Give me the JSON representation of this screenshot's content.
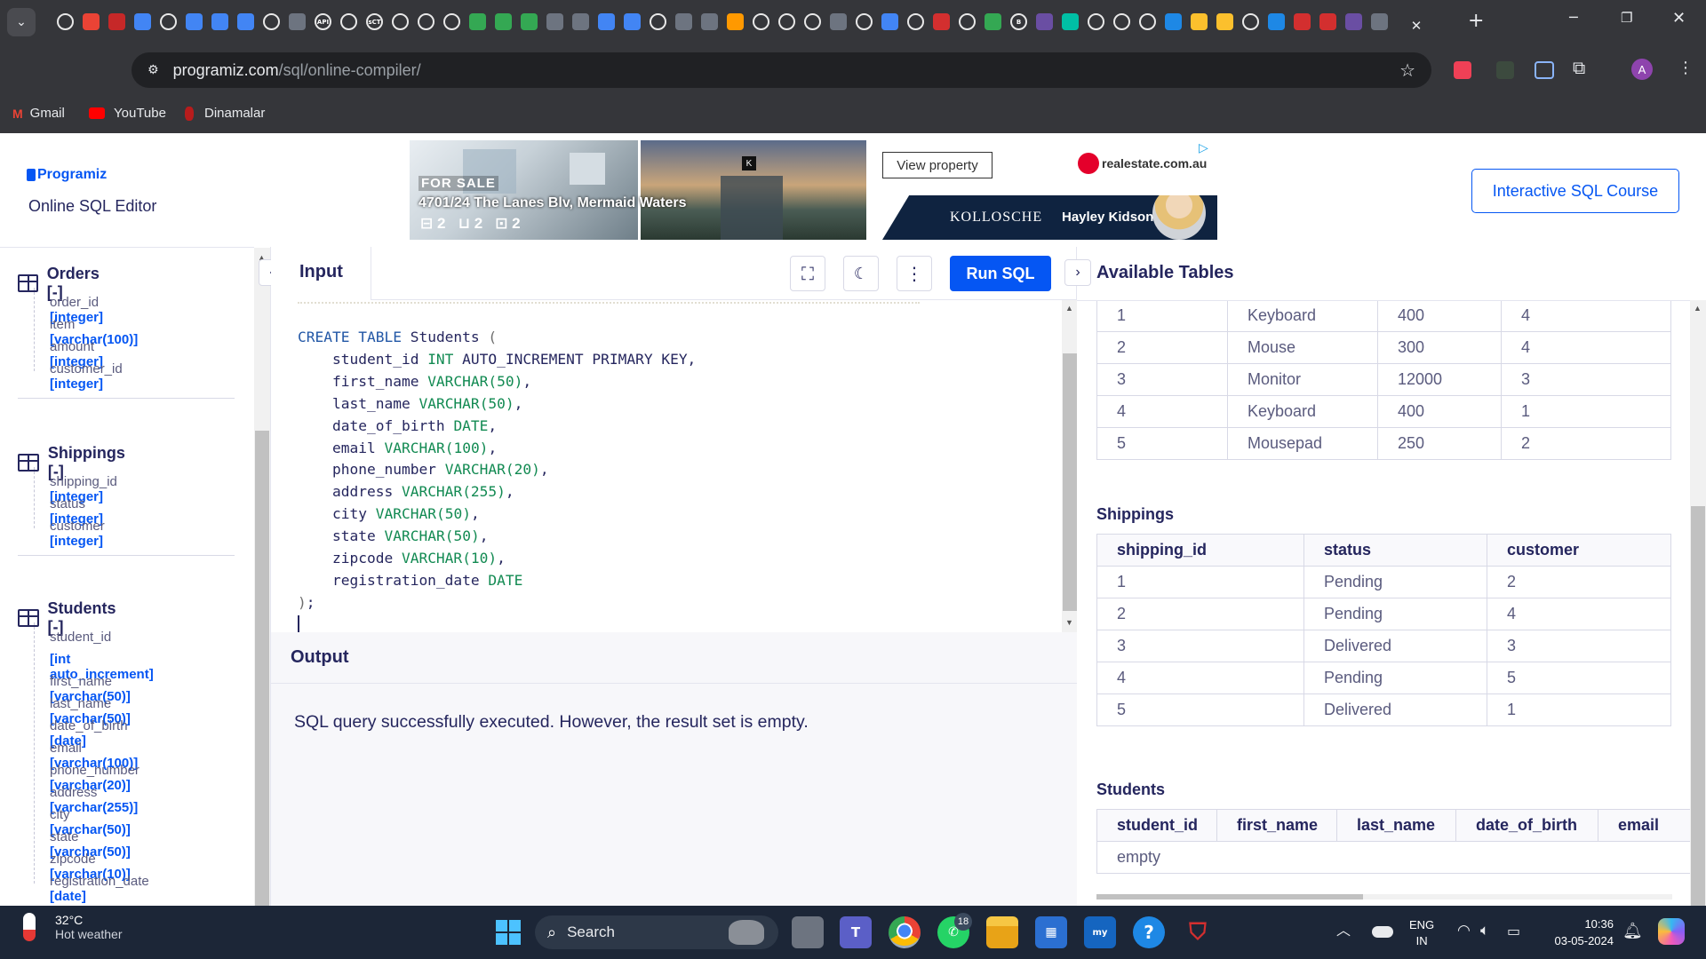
{
  "browser": {
    "tab_title_close": "✕",
    "new_tab": "+",
    "url_host": "programiz.com",
    "url_path": "/sql/online-compiler/",
    "profile_initial": "A",
    "bookmarks": [
      "Gmail",
      "YouTube",
      "Dinamalar"
    ],
    "tab_badges": [
      "API",
      "sCT",
      "B"
    ]
  },
  "ad": {
    "for_sale": "FOR SALE",
    "address": "4701/24 The Lanes Blv, Mermaid Waters",
    "beds": "2",
    "baths": "2",
    "cars": "2",
    "view_property": "View property",
    "site": "realestate.com.au",
    "agency": "KOLLOSCHE",
    "agent": "Hayley Kidson",
    "k_mark": "K"
  },
  "header": {
    "logo": "Programiz",
    "subtitle": "Online SQL Editor",
    "course_button": "Interactive SQL Course"
  },
  "sidebar": {
    "tables": [
      {
        "name": "Orders [-]",
        "columns": [
          {
            "name": "order_id",
            "type": "[integer]"
          },
          {
            "name": "item",
            "type": "[varchar(100)]"
          },
          {
            "name": "amount",
            "type": "[integer]"
          },
          {
            "name": "customer_id",
            "type": "[integer]"
          }
        ]
      },
      {
        "name": "Shippings [-]",
        "columns": [
          {
            "name": "shipping_id",
            "type": "[integer]"
          },
          {
            "name": "status",
            "type": "[integer]"
          },
          {
            "name": "customer",
            "type": "[integer]"
          }
        ]
      },
      {
        "name": "Students [-]",
        "columns": [
          {
            "name": "student_id",
            "type": ""
          },
          {
            "name": "",
            "type": "[int auto_increment]"
          },
          {
            "name": "first_name",
            "type": "[varchar(50)]"
          },
          {
            "name": "last_name",
            "type": "[varchar(50)]"
          },
          {
            "name": "date_of_birth",
            "type": "[date]"
          },
          {
            "name": "email",
            "type": "[varchar(100)]"
          },
          {
            "name": "phone_number",
            "type": "[varchar(20)]"
          },
          {
            "name": "address",
            "type": "[varchar(255)]"
          },
          {
            "name": "city",
            "type": "[varchar(50)]"
          },
          {
            "name": "state",
            "type": "[varchar(50)]"
          },
          {
            "name": "zipcode",
            "type": "[varchar(10)]"
          },
          {
            "name": "registration_date",
            "type": "[date]"
          }
        ]
      }
    ]
  },
  "editor": {
    "input_label": "Input",
    "run_button": "Run SQL",
    "output_label": "Output",
    "output_message": "SQL query successfully executed. However, the result set is empty.",
    "code_lines": [
      [
        {
          "t": "CREATE TABLE ",
          "c": "kw"
        },
        {
          "t": "Students ",
          "c": ""
        },
        {
          "t": "(",
          "c": "pn"
        }
      ],
      [
        {
          "t": "    student_id ",
          "c": ""
        },
        {
          "t": "INT ",
          "c": "ty"
        },
        {
          "t": "AUTO_INCREMENT PRIMARY KEY,",
          "c": ""
        }
      ],
      [
        {
          "t": "    first_name ",
          "c": ""
        },
        {
          "t": "VARCHAR",
          "c": "ty"
        },
        {
          "t": "(50)",
          "c": "ty"
        },
        {
          "t": ",",
          "c": ""
        }
      ],
      [
        {
          "t": "    last_name ",
          "c": ""
        },
        {
          "t": "VARCHAR",
          "c": "ty"
        },
        {
          "t": "(50)",
          "c": "ty"
        },
        {
          "t": ",",
          "c": ""
        }
      ],
      [
        {
          "t": "    date_of_birth ",
          "c": ""
        },
        {
          "t": "DATE",
          "c": "ty"
        },
        {
          "t": ",",
          "c": ""
        }
      ],
      [
        {
          "t": "    email ",
          "c": ""
        },
        {
          "t": "VARCHAR",
          "c": "ty"
        },
        {
          "t": "(100)",
          "c": "ty"
        },
        {
          "t": ",",
          "c": ""
        }
      ],
      [
        {
          "t": "    phone_number ",
          "c": ""
        },
        {
          "t": "VARCHAR",
          "c": "ty"
        },
        {
          "t": "(20)",
          "c": "ty"
        },
        {
          "t": ",",
          "c": ""
        }
      ],
      [
        {
          "t": "    address ",
          "c": ""
        },
        {
          "t": "VARCHAR",
          "c": "ty"
        },
        {
          "t": "(255)",
          "c": "ty"
        },
        {
          "t": ",",
          "c": ""
        }
      ],
      [
        {
          "t": "    city ",
          "c": ""
        },
        {
          "t": "VARCHAR",
          "c": "ty"
        },
        {
          "t": "(50)",
          "c": "ty"
        },
        {
          "t": ",",
          "c": ""
        }
      ],
      [
        {
          "t": "    state ",
          "c": ""
        },
        {
          "t": "VARCHAR",
          "c": "ty"
        },
        {
          "t": "(50)",
          "c": "ty"
        },
        {
          "t": ",",
          "c": ""
        }
      ],
      [
        {
          "t": "    zipcode ",
          "c": ""
        },
        {
          "t": "VARCHAR",
          "c": "ty"
        },
        {
          "t": "(10)",
          "c": "ty"
        },
        {
          "t": ",",
          "c": ""
        }
      ],
      [
        {
          "t": "    registration_date ",
          "c": ""
        },
        {
          "t": "DATE",
          "c": "ty"
        }
      ],
      [
        {
          "t": ")",
          "c": "pn"
        },
        {
          "t": ";",
          "c": ""
        }
      ]
    ]
  },
  "available": {
    "title": "Available Tables",
    "orders_rows": [
      [
        "1",
        "Keyboard",
        "400",
        "4"
      ],
      [
        "2",
        "Mouse",
        "300",
        "4"
      ],
      [
        "3",
        "Monitor",
        "12000",
        "3"
      ],
      [
        "4",
        "Keyboard",
        "400",
        "1"
      ],
      [
        "5",
        "Mousepad",
        "250",
        "2"
      ]
    ],
    "shippings_title": "Shippings",
    "shippings_headers": [
      "shipping_id",
      "status",
      "customer"
    ],
    "shippings_rows": [
      [
        "1",
        "Pending",
        "2"
      ],
      [
        "2",
        "Pending",
        "4"
      ],
      [
        "3",
        "Delivered",
        "3"
      ],
      [
        "4",
        "Pending",
        "5"
      ],
      [
        "5",
        "Delivered",
        "1"
      ]
    ],
    "students_title": "Students",
    "students_headers": [
      "student_id",
      "first_name",
      "last_name",
      "date_of_birth",
      "email"
    ],
    "students_empty": "empty"
  },
  "taskbar": {
    "temperature": "32°C",
    "weather": "Hot weather",
    "search": "Search",
    "whatsapp_badge": "18",
    "lang_top": "ENG",
    "lang_bottom": "IN",
    "time": "10:36",
    "date": "03-05-2024"
  },
  "colors": {
    "accent": "#0556f3",
    "chrome": "#35363a",
    "taskbar": "#1c2637"
  }
}
